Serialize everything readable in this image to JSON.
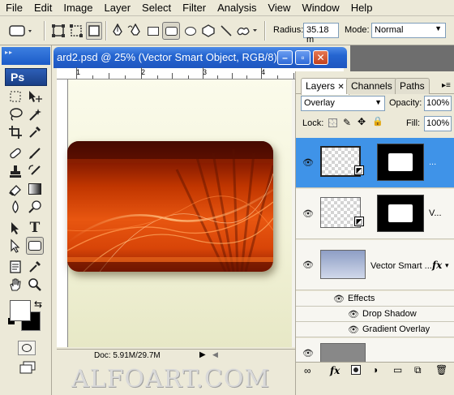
{
  "menu": [
    "File",
    "Edit",
    "Image",
    "Layer",
    "Select",
    "Filter",
    "Analysis",
    "View",
    "Window",
    "Help"
  ],
  "options": {
    "radius_label": "Radius:",
    "radius_value": "35.18 m",
    "mode_label": "Mode:",
    "mode_value": "Normal"
  },
  "toolbox": {
    "logo": "Ps"
  },
  "document": {
    "title": "ard2.psd @ 25% (Vector Smart Object, RGB/8)",
    "ruler_marks": [
      "1",
      "2",
      "3",
      "4"
    ],
    "doc_info": "Doc: 5.91M/29.7M"
  },
  "layers_panel": {
    "tabs": [
      "Layers",
      "Channels",
      "Paths"
    ],
    "blend_mode": "Overlay",
    "opacity_label": "Opacity:",
    "opacity_value": "100%",
    "lock_label": "Lock:",
    "fill_label": "Fill:",
    "fill_value": "100%",
    "layers": [
      {
        "name": "..."
      },
      {
        "name": "V..."
      },
      {
        "name": "Vector Smart ..."
      }
    ],
    "fx_label": "fx",
    "effects_label": "Effects",
    "effects": [
      "Drop Shadow",
      "Gradient Overlay"
    ]
  },
  "watermark": "ALFOART.COM"
}
